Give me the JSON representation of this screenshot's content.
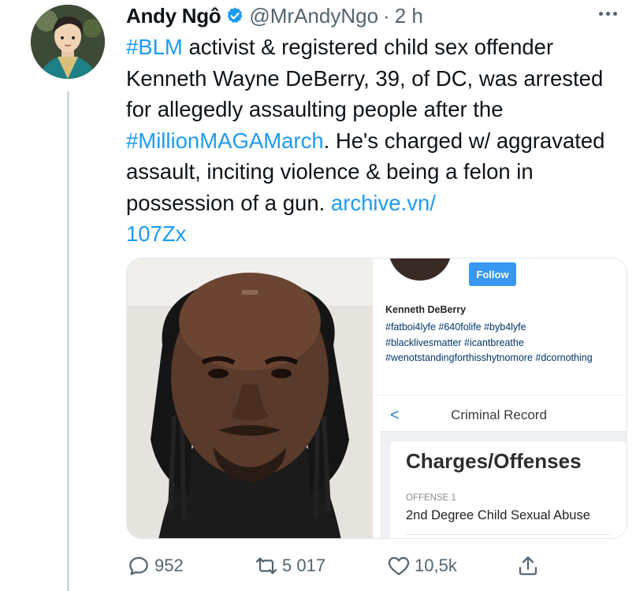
{
  "tweet": {
    "author_name": "Andy Ngô",
    "handle": "@MrAndyNgo",
    "separator": "·",
    "time": "2 h",
    "text_parts": [
      {
        "text": "#BLM",
        "link": true
      },
      {
        "text": " activist & registered child sex offender Kenneth Wayne DeBerry, 39, of DC, was arrested for allegedly assaulting people after the ",
        "link": false
      },
      {
        "text": "#MillionMAGAMarch",
        "link": true
      },
      {
        "text": ". He's charged w/ aggravated assault, inciting violence & being a felon in possession of a gun. ",
        "link": false
      },
      {
        "text": "archive.vn/\n107Zx",
        "link": true
      }
    ]
  },
  "media": {
    "instagram": {
      "follow_label": "Follow",
      "profile_name": "Kenneth DeBerry",
      "bio_lines": [
        "#fatboi4lyfe #640folife #byb4lyfe",
        "#blacklivesmatter #icantbreathe",
        "#wenotstandingforthisshytnomore #dcornothing"
      ]
    },
    "criminal_record": {
      "back_glyph": "<",
      "title": "Criminal Record",
      "heading": "Charges/Offenses",
      "offense_label": "OFFENSE 1",
      "offense_value": "2nd Degree Child Sexual Abuse"
    }
  },
  "actions": {
    "replies": "952",
    "retweets": "5 017",
    "likes": "10,5k"
  },
  "colors": {
    "link": "#1d9bf0",
    "muted": "#536471",
    "verified": "#1d9bf0",
    "follow_button": "#3897f0"
  }
}
